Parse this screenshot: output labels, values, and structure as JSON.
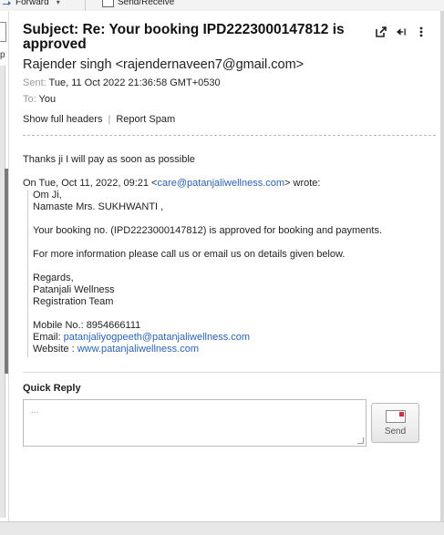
{
  "toolbar": {
    "forward_label": "Forward",
    "send_receive_label": "Send/Receive"
  },
  "left_panel": {
    "fragment_text": "p"
  },
  "email": {
    "subject": "Subject: Re: Your booking IPD2223000147812 is approved",
    "from": "Rajender singh <rajendernaveen7@gmail.com>",
    "sent_label": "Sent:",
    "sent_value": "Tue, 11 Oct 2022 21:36:58 GMT+0530",
    "to_label": "To:",
    "to_value": "You",
    "show_full_headers": "Show full headers",
    "report_spam": "Report Spam",
    "body_line1": "Thanks ji I will pay as soon as possible",
    "quote_intro_pre": "On Tue, Oct 11, 2022, 09:21 <",
    "quote_intro_email": "care@patanjaliwellness.com",
    "quote_intro_post": "> wrote:",
    "quote": {
      "greeting1": "Om Ji,",
      "greeting2": "Namaste Mrs. SUKHWANTI ,",
      "para1": "Your booking no. (IPD2223000147812) is approved for booking and payments.",
      "para2": "For more information please call us or email us on details given below.",
      "regards": "Regards,",
      "org": "Patanjali Wellness",
      "team": "Registration Team",
      "mobile": "Mobile No.: 8954666111",
      "email_label": "Email: ",
      "email_value": "patanjaliyogpeeth@patanjaliwellness.com",
      "website_label": "Website : ",
      "website_value": "www.patanjaliwellness.com"
    }
  },
  "quick_reply": {
    "title": "Quick Reply",
    "placeholder": "...",
    "send_label": "Send"
  }
}
